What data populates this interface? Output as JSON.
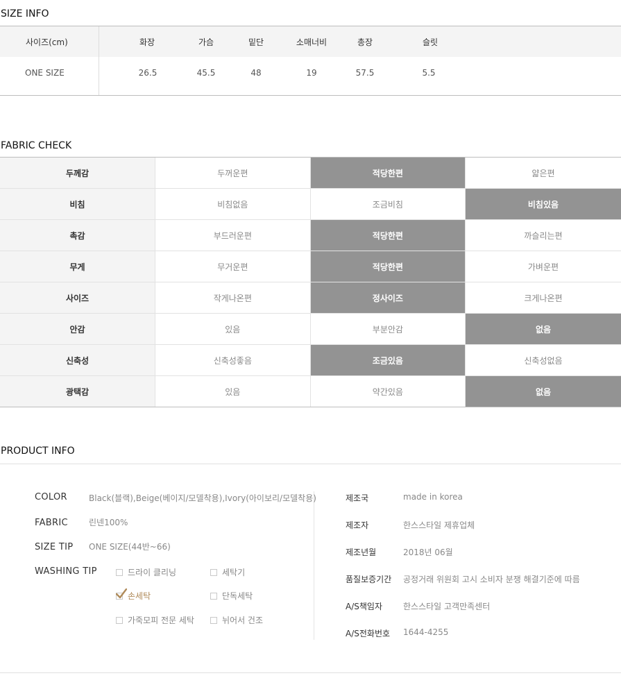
{
  "size_info": {
    "title": "SIZE INFO",
    "headers": [
      "사이즈(cm)",
      "화장",
      "가슴",
      "밑단",
      "소매너비",
      "총장",
      "슬릿"
    ],
    "row": [
      "ONE SIZE",
      "26.5",
      "45.5",
      "48",
      "19",
      "57.5",
      "5.5"
    ]
  },
  "fabric_check": {
    "title": "FABRIC CHECK",
    "rows": [
      {
        "label": "두께감",
        "options": [
          "두꺼운편",
          "적당한편",
          "얇은편"
        ],
        "selected": 1
      },
      {
        "label": "비침",
        "options": [
          "비침없음",
          "조금비침",
          "비침있음"
        ],
        "selected": 2
      },
      {
        "label": "촉감",
        "options": [
          "부드러운편",
          "적당한편",
          "까슬리는편"
        ],
        "selected": 1
      },
      {
        "label": "무게",
        "options": [
          "무거운편",
          "적당한편",
          "가벼운편"
        ],
        "selected": 1
      },
      {
        "label": "사이즈",
        "options": [
          "작게나온편",
          "정사이즈",
          "크게나온편"
        ],
        "selected": 1
      },
      {
        "label": "안감",
        "options": [
          "있음",
          "부분안감",
          "없음"
        ],
        "selected": 2
      },
      {
        "label": "신축성",
        "options": [
          "신축성좋음",
          "조금있음",
          "신축성없음"
        ],
        "selected": 1
      },
      {
        "label": "광택감",
        "options": [
          "있음",
          "약간있음",
          "없음"
        ],
        "selected": 2
      }
    ]
  },
  "product_info": {
    "title": "PRODUCT INFO",
    "color_label": "COLOR",
    "color_value": "Black(블랙),Beige(베이지/모델착용),Ivory(아이보리/모델착용)",
    "fabric_label": "FABRIC",
    "fabric_value": "린넨100%",
    "size_tip_label": "SIZE TIP",
    "size_tip_value": "ONE SIZE(44반~66)",
    "washing_label": "WASHING TIP",
    "washing": {
      "dry_cleaning": "드라이 클리닝",
      "washer": "세탁기",
      "hand_wash": "손세탁",
      "separate_wash": "단독세탁",
      "leather_pro": "가죽모피 전문 세탁",
      "lay_flat_dry": "뉘어서 건조",
      "checked": "hand_wash"
    },
    "details": [
      {
        "label": "제조국",
        "value": "made in korea"
      },
      {
        "label": "제조자",
        "value": "한스스타일 제휴업체"
      },
      {
        "label": "제조년월",
        "value": "2018년 06월"
      },
      {
        "label": "품질보증기간",
        "value": "공정거래 위원회 고시 소비자 분쟁 해결기준에 따름"
      },
      {
        "label": "A/S책임자",
        "value": "한스스타일 고객만족센터"
      },
      {
        "label": "A/S전화번호",
        "value": "1644-4255"
      }
    ]
  },
  "colors": {
    "selected_bg": "#939393",
    "label_bg": "#f4f4f4",
    "check_accent": "#b08b5a"
  }
}
